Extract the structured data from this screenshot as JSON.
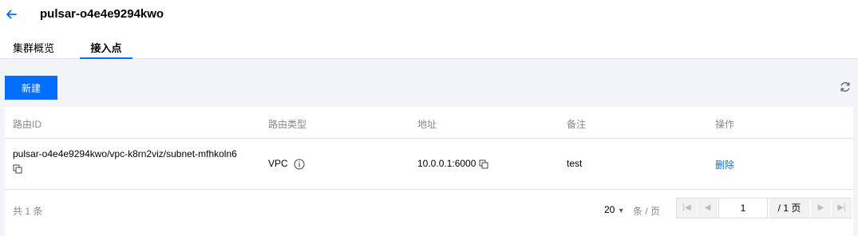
{
  "header": {
    "title": "pulsar-o4e4e9294kwo"
  },
  "tabs": [
    {
      "label": "集群概览"
    },
    {
      "label": "接入点"
    }
  ],
  "toolbar": {
    "new_label": "新建"
  },
  "table": {
    "columns": [
      "路由ID",
      "路由类型",
      "地址",
      "备注",
      "操作"
    ],
    "rows": [
      {
        "route_id": "pulsar-o4e4e9294kwo/vpc-k8rn2viz/subnet-mfhkoln6",
        "route_type": "VPC",
        "address": "10.0.0.1:6000",
        "note": "test",
        "action": "删除"
      }
    ]
  },
  "pagination": {
    "total": "共 1 条",
    "page_size": "20",
    "per_page_label": "条 / 页",
    "current_page": "1",
    "total_pages": "/ 1 页"
  },
  "colors": {
    "primary": "#006eff",
    "content_bg": "#f3f4f7"
  }
}
